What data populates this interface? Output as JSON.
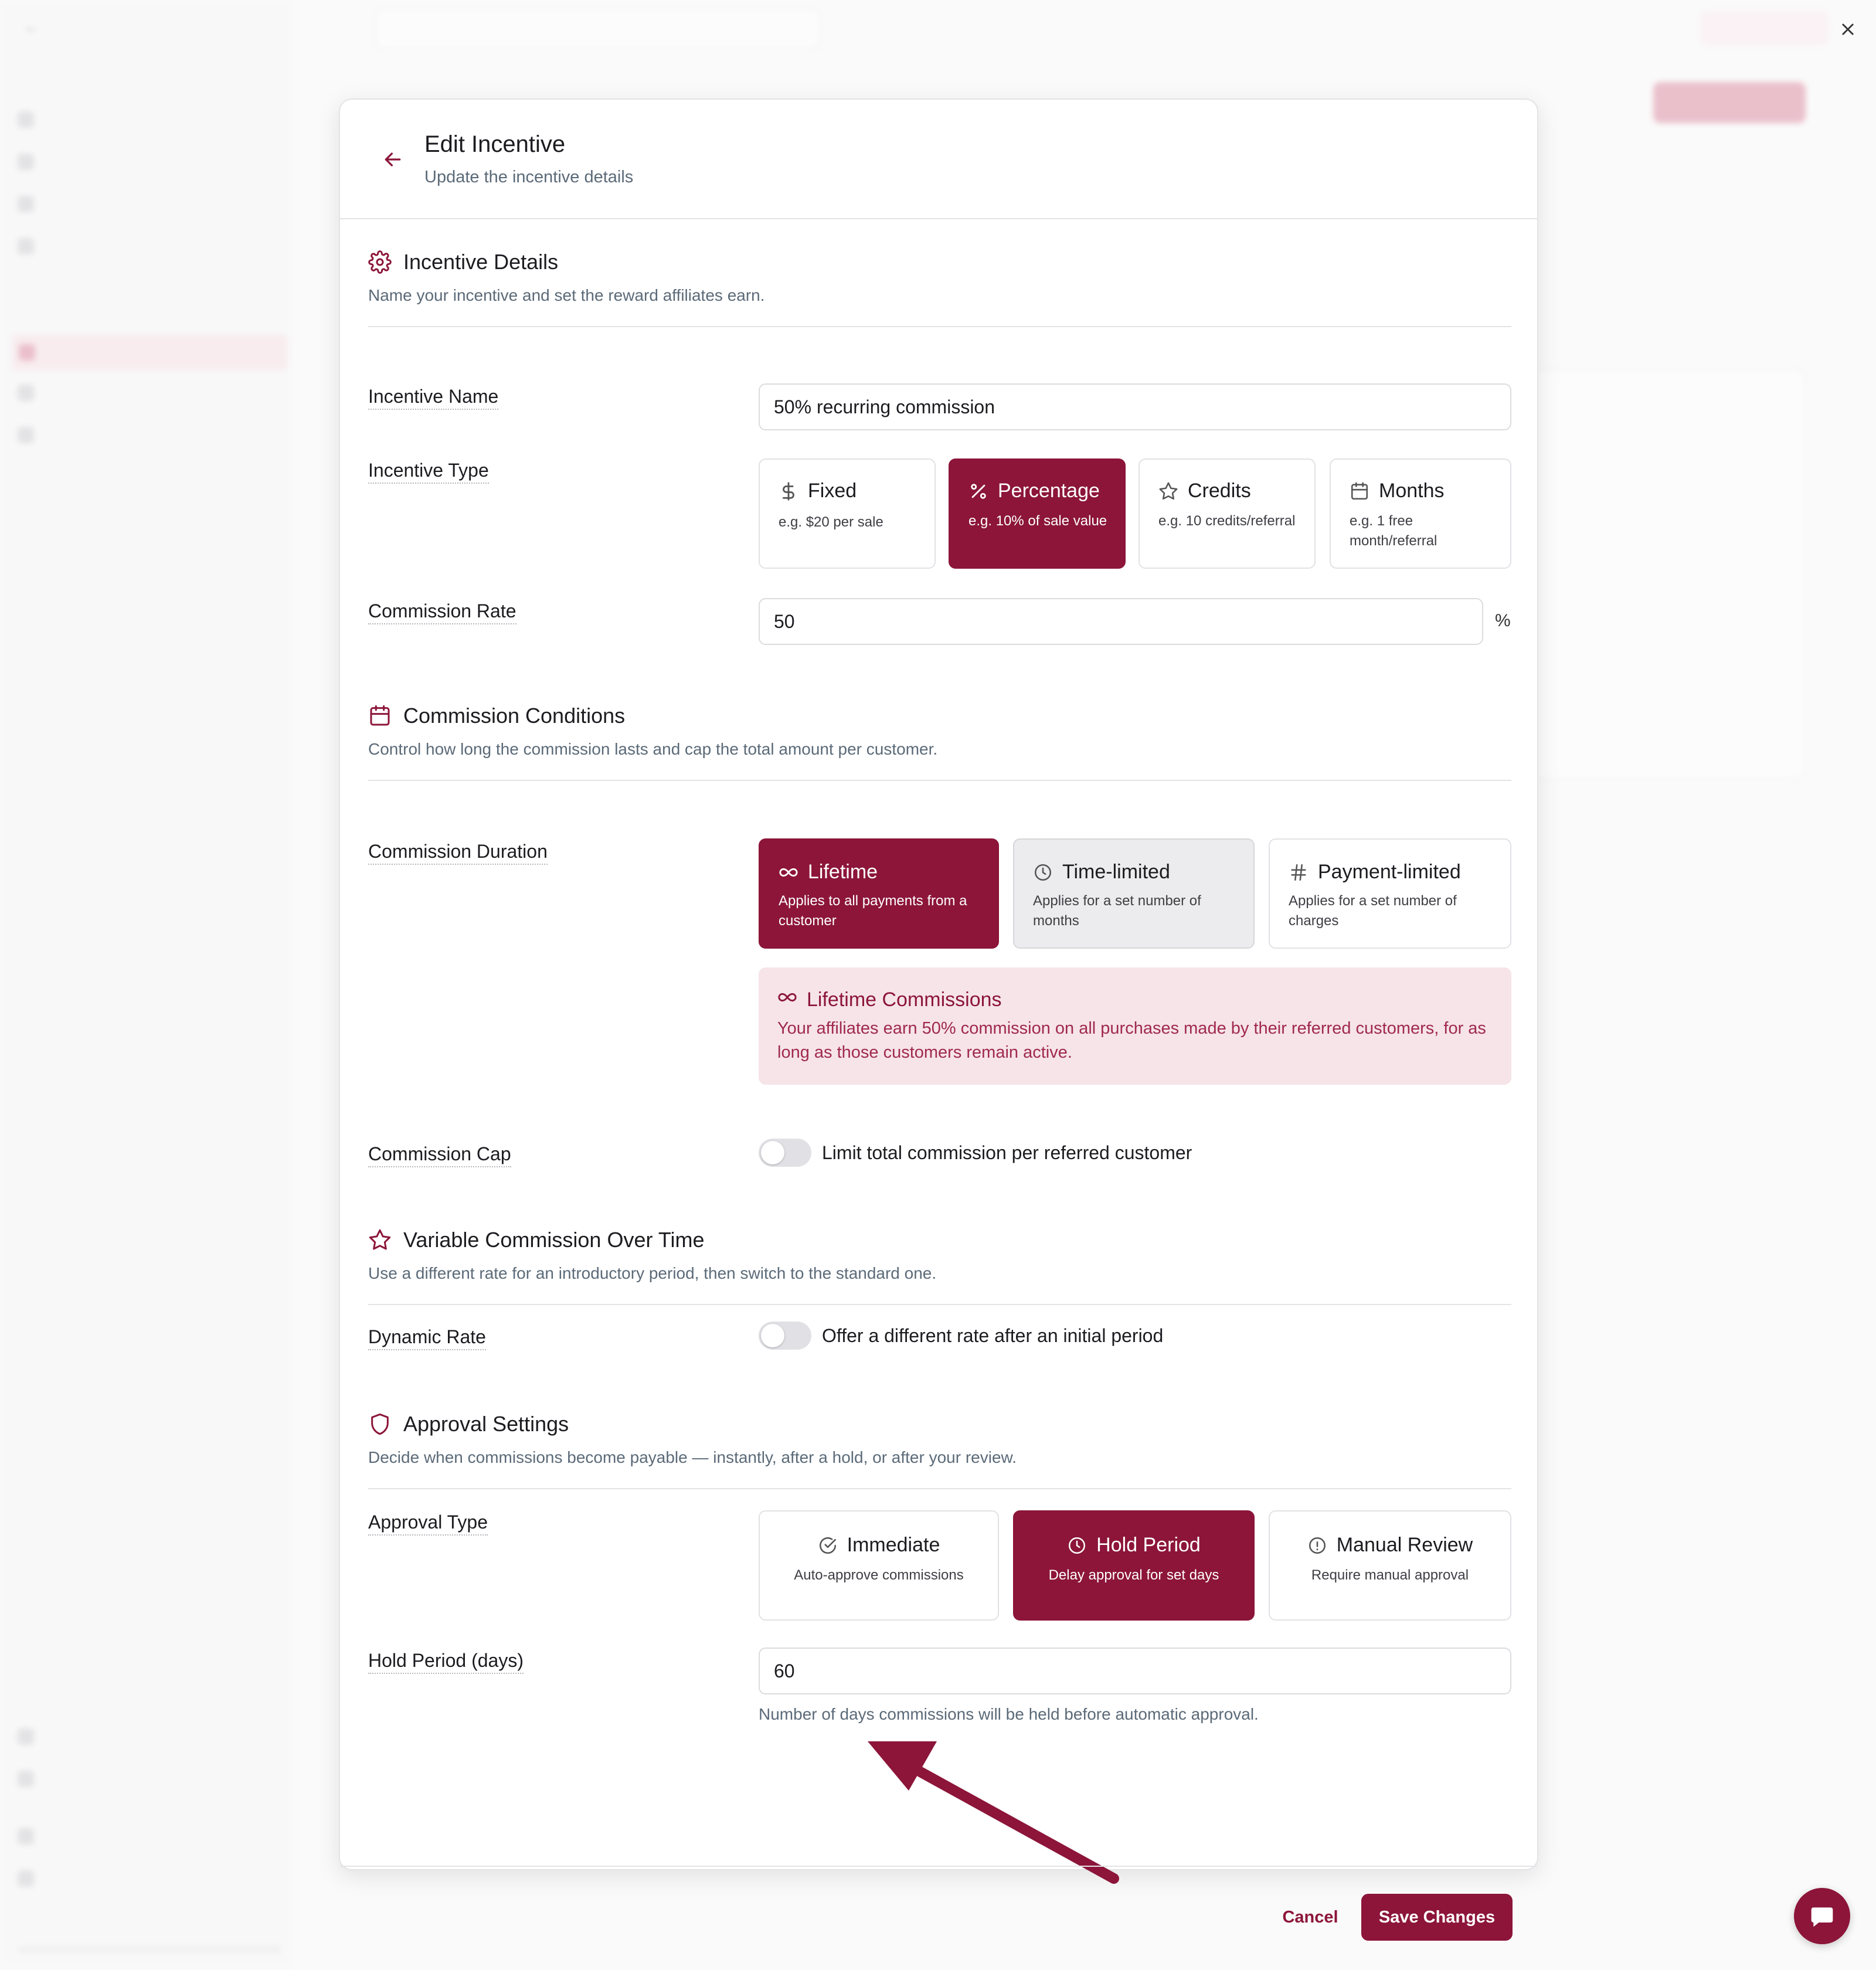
{
  "modal": {
    "title": "Edit Incentive",
    "subtitle": "Update the incentive details"
  },
  "sections": {
    "incentive_details": {
      "title": "Incentive Details",
      "description": "Name your incentive and set the reward affiliates earn.",
      "icon": "gear-icon"
    },
    "commission_conditions": {
      "title": "Commission Conditions",
      "description": "Control how long the commission lasts and cap the total amount per customer.",
      "icon": "calendar-icon"
    },
    "variable_commission": {
      "title": "Variable Commission Over Time",
      "description": "Use a different rate for an introductory period, then switch to the standard one.",
      "icon": "star-icon"
    },
    "approval_settings": {
      "title": "Approval Settings",
      "description": "Decide when commissions become payable — instantly, after a hold, or after your review.",
      "icon": "shield-icon"
    }
  },
  "fields": {
    "incentive_name": {
      "label": "Incentive Name",
      "value": "50% recurring commission"
    },
    "incentive_type": {
      "label": "Incentive Type",
      "selected": "Percentage",
      "options": [
        {
          "label": "Fixed",
          "desc": "e.g. $20 per sale",
          "icon": "dollar-icon"
        },
        {
          "label": "Percentage",
          "desc": "e.g. 10% of sale value",
          "icon": "percent-icon"
        },
        {
          "label": "Credits",
          "desc": "e.g. 10 credits/referral",
          "icon": "star-icon"
        },
        {
          "label": "Months",
          "desc": "e.g. 1 free month/referral",
          "icon": "calendar-icon"
        }
      ]
    },
    "commission_rate": {
      "label": "Commission Rate",
      "value": "50",
      "suffix": "%"
    },
    "commission_duration": {
      "label": "Commission Duration",
      "selected": "Lifetime",
      "options": [
        {
          "label": "Lifetime",
          "desc": "Applies to all payments from a customer",
          "icon": "infinity-icon"
        },
        {
          "label": "Time-limited",
          "desc": "Applies for a set number of months",
          "icon": "clock-icon"
        },
        {
          "label": "Payment-limited",
          "desc": "Applies for a set number of charges",
          "icon": "hash-icon"
        }
      ]
    },
    "lifetime_info": {
      "title": "Lifetime Commissions",
      "text": "Your affiliates earn 50% commission on all purchases made by their referred customers, for as long as those customers remain active."
    },
    "commission_cap": {
      "label": "Commission Cap",
      "toggle_label": "Limit total commission per referred customer",
      "enabled": false
    },
    "dynamic_rate": {
      "label": "Dynamic Rate",
      "toggle_label": "Offer a different rate after an initial period",
      "enabled": false
    },
    "approval_type": {
      "label": "Approval Type",
      "selected": "Hold Period",
      "options": [
        {
          "label": "Immediate",
          "desc": "Auto-approve commissions",
          "icon": "check-circle-icon"
        },
        {
          "label": "Hold Period",
          "desc": "Delay approval for set days",
          "icon": "clock-icon"
        },
        {
          "label": "Manual Review",
          "desc": "Require manual approval",
          "icon": "alert-circle-icon"
        }
      ]
    },
    "hold_period": {
      "label": "Hold Period (days)",
      "value": "60",
      "help": "Number of days commissions will be held before automatic approval."
    }
  },
  "footer": {
    "cancel_label": "Cancel",
    "save_label": "Save Changes"
  },
  "colors": {
    "accent": "#8c1539",
    "accent_light": "#f6e4e9",
    "muted_text": "#5b6a78"
  }
}
